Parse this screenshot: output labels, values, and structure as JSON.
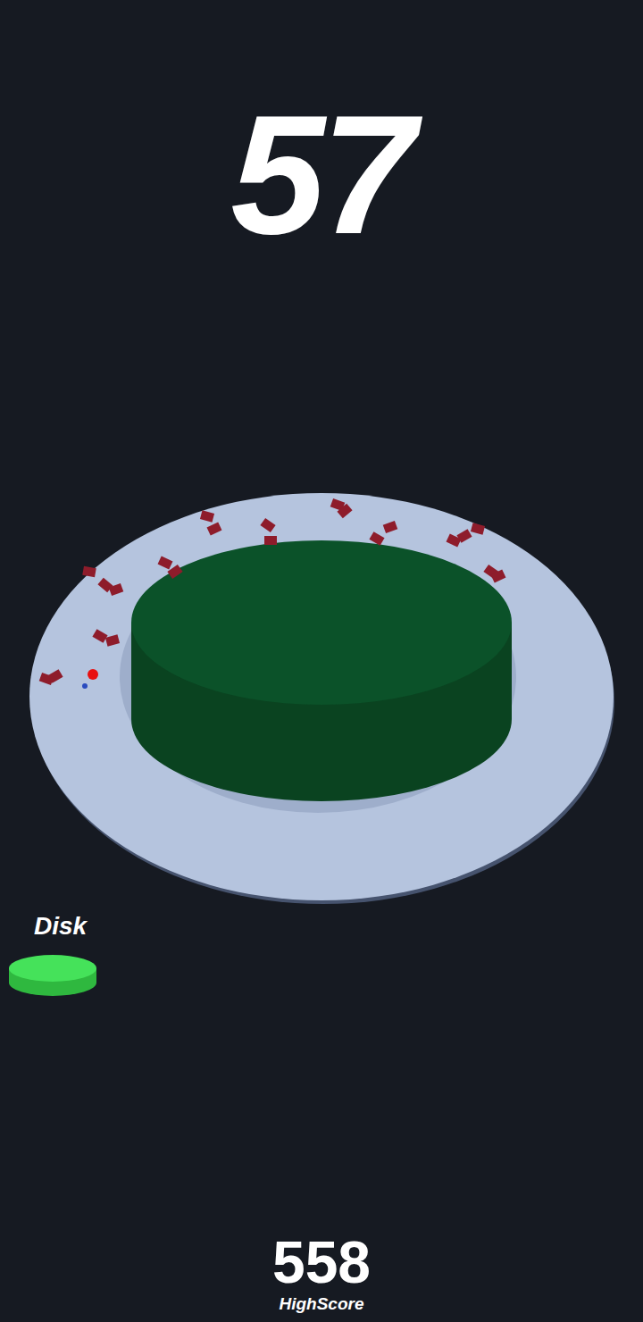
{
  "score": "57",
  "next_piece": {
    "label": "Disk"
  },
  "high_score": {
    "value": "558",
    "label": "HighScore"
  }
}
